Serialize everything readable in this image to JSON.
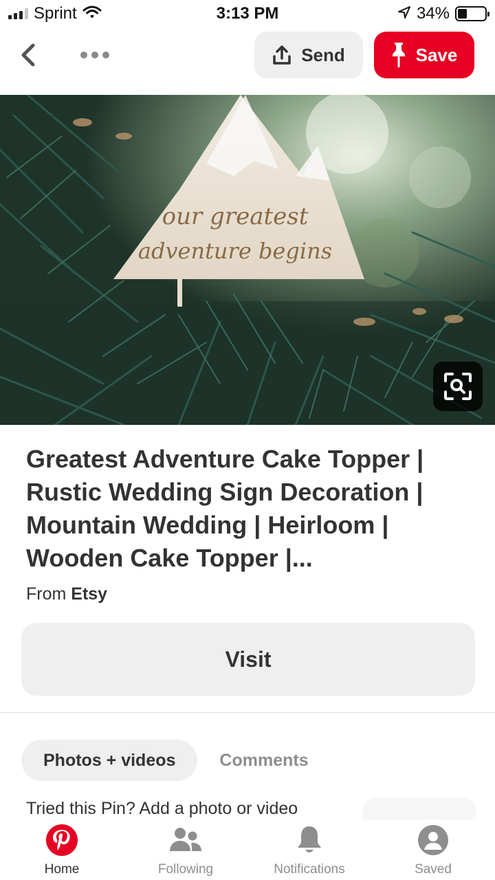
{
  "status_bar": {
    "carrier": "Sprint",
    "time": "3:13 PM",
    "battery": "34%",
    "battery_level": 0.34,
    "icons": [
      "signal-icon",
      "wifi-icon",
      "location-arrow-icon",
      "battery-icon"
    ]
  },
  "toolbar": {
    "back_icon": "chevron-left-icon",
    "more_icon": "more-dots-icon",
    "send_label": "Send",
    "save_label": "Save"
  },
  "pin": {
    "image_text": "our greatest adventure begins",
    "title": "Greatest Adventure Cake Topper | Rustic Wedding Sign Decoration | Mountain Wedding | Heirloom | Wooden Cake Topper |...",
    "source_prefix": "From",
    "source_name": "Etsy",
    "visit_label": "Visit"
  },
  "tabs": [
    {
      "label": "Photos + videos",
      "active": true
    },
    {
      "label": "Comments",
      "active": false
    }
  ],
  "tried": {
    "text": "Tried this Pin? Add a photo or video"
  },
  "bottom_nav": [
    {
      "label": "Home",
      "icon": "pinterest-logo-icon",
      "active": true
    },
    {
      "label": "Following",
      "icon": "people-icon",
      "active": false
    },
    {
      "label": "Notifications",
      "icon": "bell-icon",
      "active": false
    },
    {
      "label": "Saved",
      "icon": "profile-icon",
      "active": false
    }
  ],
  "colors": {
    "brand_red": "#e60023",
    "button_gray": "#efefef",
    "text_dark": "#333333",
    "text_muted": "#8e8e8e"
  }
}
